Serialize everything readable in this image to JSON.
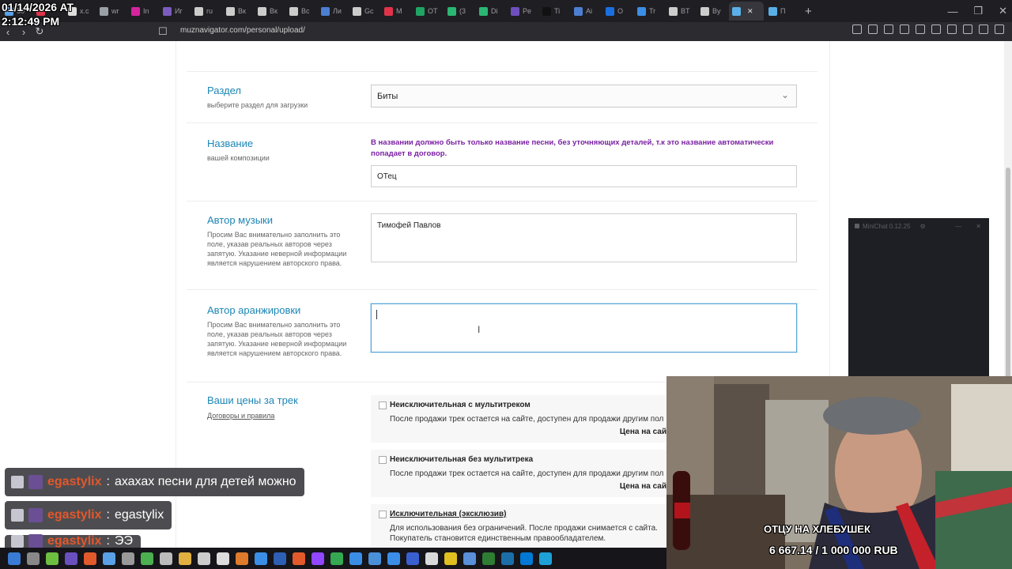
{
  "browser": {
    "tabs": [
      {
        "label": "50",
        "color": "#5aa0e6"
      },
      {
        "label": "",
        "color": "#e0334a"
      },
      {
        "label": "x.c",
        "color": "#dddddd"
      },
      {
        "label": "wr",
        "color": "#9aa0a6"
      },
      {
        "label": "In",
        "color": "#d6249f"
      },
      {
        "label": "Иг",
        "color": "#7c5cbf"
      },
      {
        "label": "ru",
        "color": "#cccccc"
      },
      {
        "label": "Вк",
        "color": "#cccccc"
      },
      {
        "label": "Вк",
        "color": "#cccccc"
      },
      {
        "label": "Вс",
        "color": "#cccccc"
      },
      {
        "label": "Ли",
        "color": "#4c7fd1"
      },
      {
        "label": "Gc",
        "color": "#cccccc"
      },
      {
        "label": "M",
        "color": "#e0334a"
      },
      {
        "label": "OT",
        "color": "#1fa463"
      },
      {
        "label": "(3",
        "color": "#2bb673"
      },
      {
        "label": "Di",
        "color": "#2bb673"
      },
      {
        "label": "Pe",
        "color": "#6e4fbf"
      },
      {
        "label": "Ti",
        "color": "#111111"
      },
      {
        "label": "Ai",
        "color": "#4c7fd1"
      },
      {
        "label": "O",
        "color": "#1a6fe0"
      },
      {
        "label": "Tr",
        "color": "#3a8ee6"
      },
      {
        "label": "BT",
        "color": "#cccccc"
      },
      {
        "label": "By",
        "color": "#cccccc"
      },
      {
        "label": "",
        "color": "#5ab0e6",
        "active": true
      },
      {
        "label": "П",
        "color": "#5ab0e6"
      }
    ],
    "url": "muznavigator.com/personal/upload/",
    "minichat_title": "MiniChat 0.12.25"
  },
  "overlay": {
    "timestamp_date": "01/14/2026 AT",
    "timestamp_time": "2:12:49 PM",
    "chat": [
      {
        "nick": "egastylix",
        "text": "ахахах песни для детей можно"
      },
      {
        "nick": "egastylix",
        "text": "egastylix"
      },
      {
        "nick": "egastylix",
        "text": "ЭЭ"
      }
    ],
    "donation_label": "ОТЦУ НА ХЛЕБУШЕК",
    "donation_value": "6 667.14 / 1 000 000 RUB"
  },
  "form": {
    "section": {
      "label": "Раздел",
      "sub": "выберите раздел для загрузки",
      "value": "Биты"
    },
    "title": {
      "label": "Название",
      "sub": "вашей композиции",
      "warning": "В названии должно быть только название песни, без уточняющих деталей, т.к это название автоматически попадает в договор.",
      "value": "ОТец"
    },
    "music_author": {
      "label": "Автор музыки",
      "sub": "Просим Вас внимательно заполнить это поле, указав реальных авторов через запятую. Указание неверной информации является нарушением авторского права.",
      "value": "Тимофей Павлов"
    },
    "arrangement_author": {
      "label": "Автор аранжировки",
      "sub": "Просим Вас внимательно заполнить это поле, указав реальных авторов через запятую. Указание неверной информации является нарушением авторского права.",
      "value": ""
    },
    "prices": {
      "label": "Ваши цены за трек",
      "sub": "Договоры и правила",
      "options": [
        {
          "title": "Неисключительная с мультитреком",
          "desc": "После продажи трек остается на сайте, доступен для продажи другим пол",
          "price": "Цена на сай"
        },
        {
          "title": "Неисключительная без мультитрека",
          "desc": "После продажи трек остается на сайте, доступен для продажи другим пол",
          "price": "Цена на сай"
        },
        {
          "title": "Исключительная (эксклюзив)",
          "desc": "Для использования без ограничений. После продажи снимается с сайта.",
          "desc2": "Покупатель становится единственным правообладателем."
        }
      ]
    }
  }
}
